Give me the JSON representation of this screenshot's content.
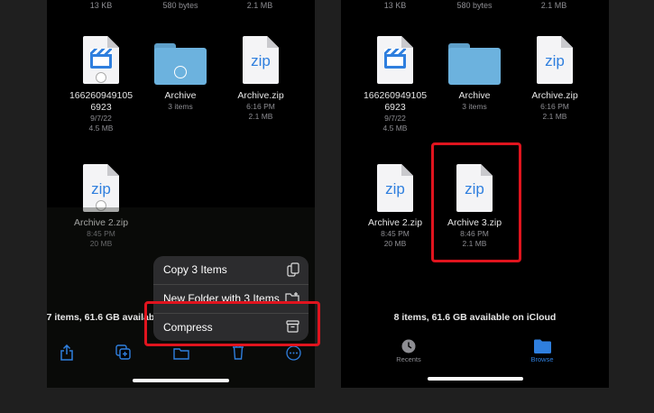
{
  "left_screen": {
    "top_row": [
      "13 KB",
      "580 bytes",
      "2.1 MB"
    ],
    "files": [
      {
        "name_line1": "166260949105",
        "name_line2": "6923",
        "date": "9/7/22",
        "size": "4.5 MB",
        "icon": "video-file-icon"
      },
      {
        "name": "Archive",
        "meta": "3 items",
        "icon": "folder-icon"
      },
      {
        "name": "Archive.zip",
        "time": "6:16 PM",
        "size": "2.1 MB",
        "icon": "zip-file-icon"
      },
      {
        "name": "Archive 2.zip",
        "time": "8:45 PM",
        "size": "20 MB",
        "icon": "zip-file-icon"
      }
    ],
    "status": "7 items, 61.6 GB available on iCloud",
    "context_menu": {
      "items": [
        {
          "label": "Copy 3 Items",
          "icon": "copy-icon"
        },
        {
          "label": "New Folder with 3 Items",
          "icon": "new-folder-icon"
        },
        {
          "label": "Compress",
          "icon": "archive-box-icon"
        }
      ]
    },
    "toolbar_icons": [
      "share-icon",
      "duplicate-icon",
      "move-folder-icon",
      "trash-icon",
      "more-icon"
    ]
  },
  "right_screen": {
    "top_row": [
      "13 KB",
      "580 bytes",
      "2.1 MB"
    ],
    "files": [
      {
        "name_line1": "166260949105",
        "name_line2": "6923",
        "date": "9/7/22",
        "size": "4.5 MB"
      },
      {
        "name": "Archive",
        "meta": "3 items"
      },
      {
        "name": "Archive.zip",
        "time": "6:16 PM",
        "size": "2.1 MB"
      },
      {
        "name": "Archive 2.zip",
        "time": "8:45 PM",
        "size": "20 MB"
      },
      {
        "name": "Archive 3.zip",
        "time": "8:46 PM",
        "size": "2.1 MB"
      }
    ],
    "status": "8 items, 61.6 GB available on iCloud",
    "tabs": [
      {
        "label": "Recents",
        "icon": "clock-icon",
        "active": false
      },
      {
        "label": "Browse",
        "icon": "folder-tab-icon",
        "active": true
      }
    ]
  },
  "colors": {
    "accent": "#2f7fde",
    "highlight": "#e0141e",
    "background": "#000000"
  }
}
